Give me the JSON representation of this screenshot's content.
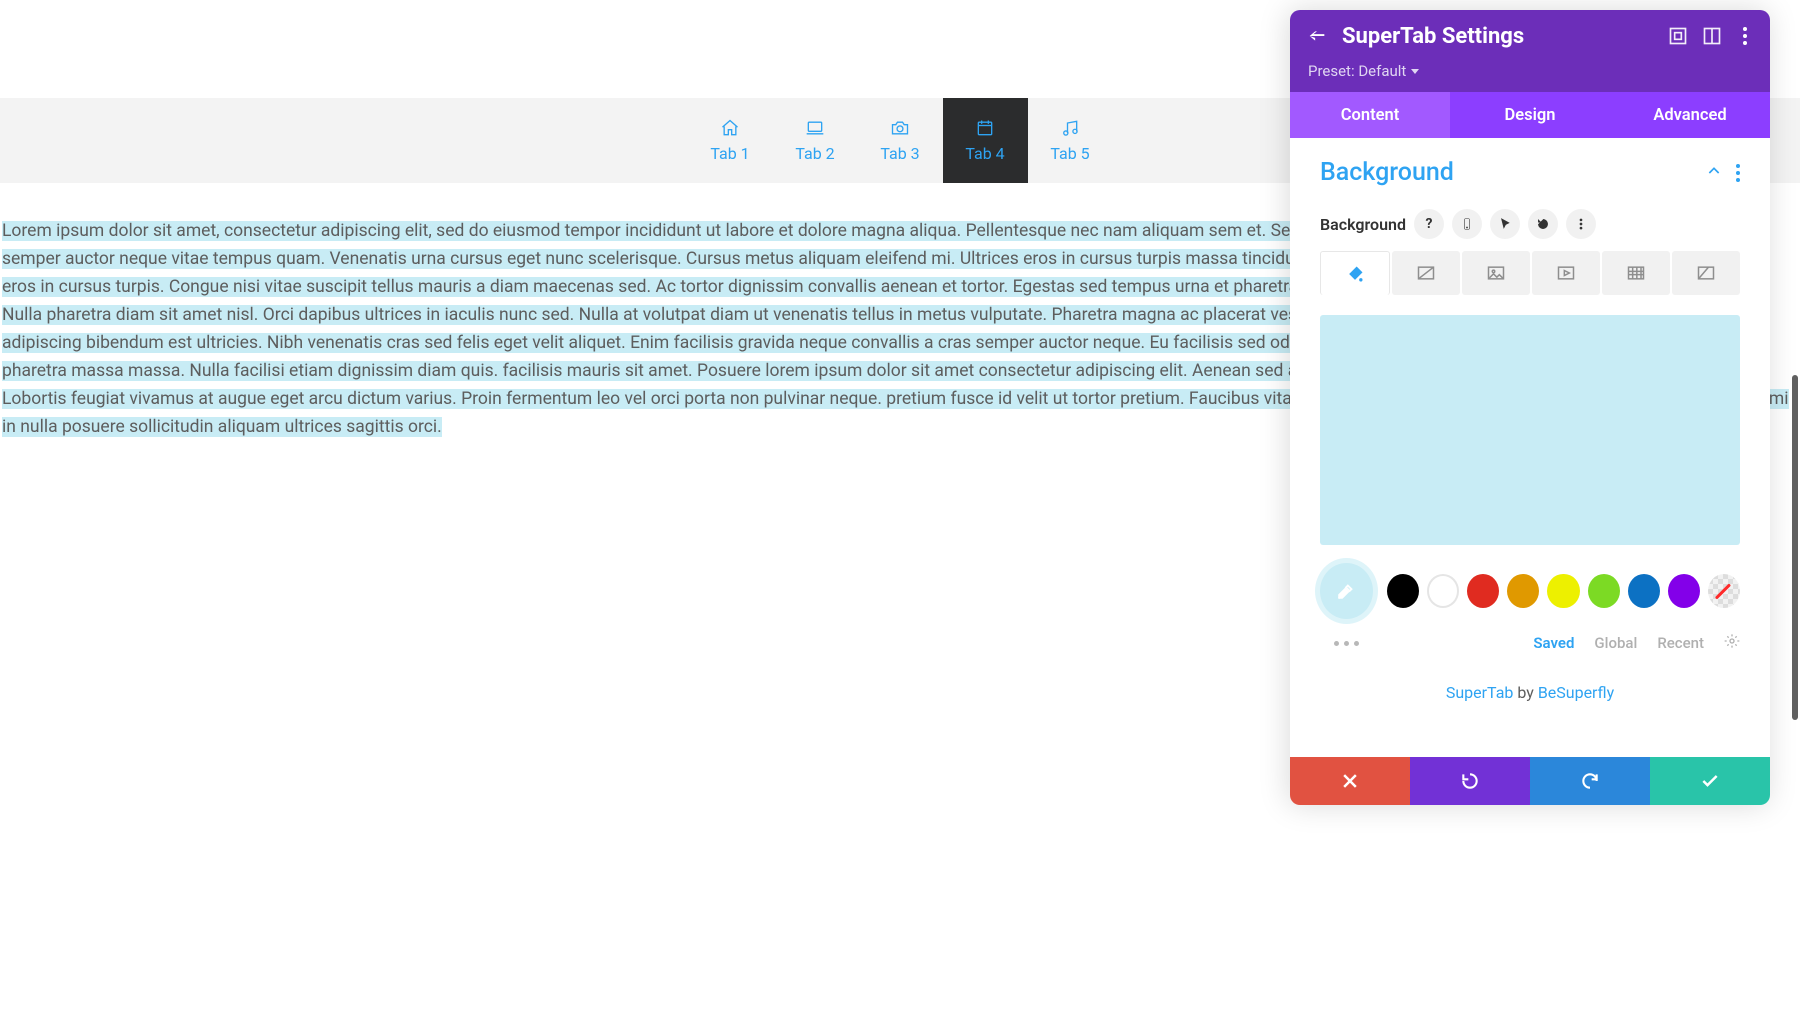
{
  "preview": {
    "tabs": [
      {
        "label": "Tab 1",
        "icon": "home-icon"
      },
      {
        "label": "Tab 2",
        "icon": "laptop-icon"
      },
      {
        "label": "Tab 3",
        "icon": "camera-icon"
      },
      {
        "label": "Tab 4",
        "icon": "calendar-icon",
        "active": true
      },
      {
        "label": "Tab 5",
        "icon": "music-icon"
      }
    ],
    "body_text": "Lorem ipsum dolor sit amet, consectetur adipiscing elit, sed do eiusmod tempor incididunt ut labore et dolore magna aliqua. Pellentesque nec nam aliquam sem et. Sed elementum tempus egestas sed. Neque convallis a cras semper auctor neque vitae tempus quam. Venenatis urna cursus eget nunc scelerisque. Cursus metus aliquam eleifend mi. Ultrices eros in cursus turpis massa tincidunt dui ut ornare. Ac placerat vestibulum lectus mauris ultrices eros in cursus turpis. Congue nisi vitae suscipit tellus mauris a diam maecenas sed. Ac tortor dignissim convallis aenean et tortor. Egestas sed tempus urna et pharetra pharetra massa massa. Enim neque volutpat ac tincidunt. Nulla pharetra diam sit amet nisl. Orci dapibus ultrices in iaculis nunc sed. Nulla at volutpat diam ut venenatis tellus in metus vulputate. Pharetra magna ac placerat vestibulum lectus mauris ultrices eros in. Amet nisl suscipit adipiscing bibendum est ultricies. Nibh venenatis cras sed felis eget velit aliquet. Enim facilisis gravida neque convallis a cras semper auctor neque. Eu facilisis sed odio morbi quis. Turpis egestas sed tempus urna et pharetra pharetra massa massa. Nulla facilisi etiam dignissim diam quis. facilisis mauris sit amet. Posuere lorem ipsum dolor sit amet consectetur adipiscing elit. Aenean sed adipiscing diam donec adipiscing tristique risus nec feugiat. Lobortis feugiat vivamus at augue eget arcu dictum varius. Proin fermentum leo vel orci porta non pulvinar neque. pretium fusce id velit ut tortor pretium. Faucibus vitae aliquet nec ullamcorper sit amet risus nullam eget. Eleifend mi in nulla posuere sollicitudin aliquam ultrices sagittis orci.",
    "highlighted_background": "#c8ecf5"
  },
  "panel": {
    "title": "SuperTab Settings",
    "preset_label": "Preset: Default",
    "tabs": {
      "content": "Content",
      "design": "Design",
      "advanced": "Advanced",
      "active": "content"
    },
    "section": {
      "title": "Background",
      "field_label": "Background",
      "color_preview": "#c8ecf5",
      "swatches": {
        "palette": [
          {
            "name": "eyedropper",
            "type": "tool"
          },
          {
            "name": "black",
            "value": "#000000"
          },
          {
            "name": "white",
            "value": "#ffffff",
            "outline": true
          },
          {
            "name": "red",
            "value": "#e02b20"
          },
          {
            "name": "orange",
            "value": "#e09900"
          },
          {
            "name": "yellow",
            "value": "#edf000"
          },
          {
            "name": "green",
            "value": "#7cda24"
          },
          {
            "name": "blue",
            "value": "#0c71c3"
          },
          {
            "name": "purple",
            "value": "#8300e9"
          },
          {
            "name": "transparent",
            "type": "transparent"
          }
        ],
        "swatch_tabs": {
          "saved": "Saved",
          "global": "Global",
          "recent": "Recent",
          "active": "saved"
        }
      }
    },
    "credit": {
      "product": "SuperTab",
      "by": " by ",
      "author": "BeSuperfly"
    }
  }
}
